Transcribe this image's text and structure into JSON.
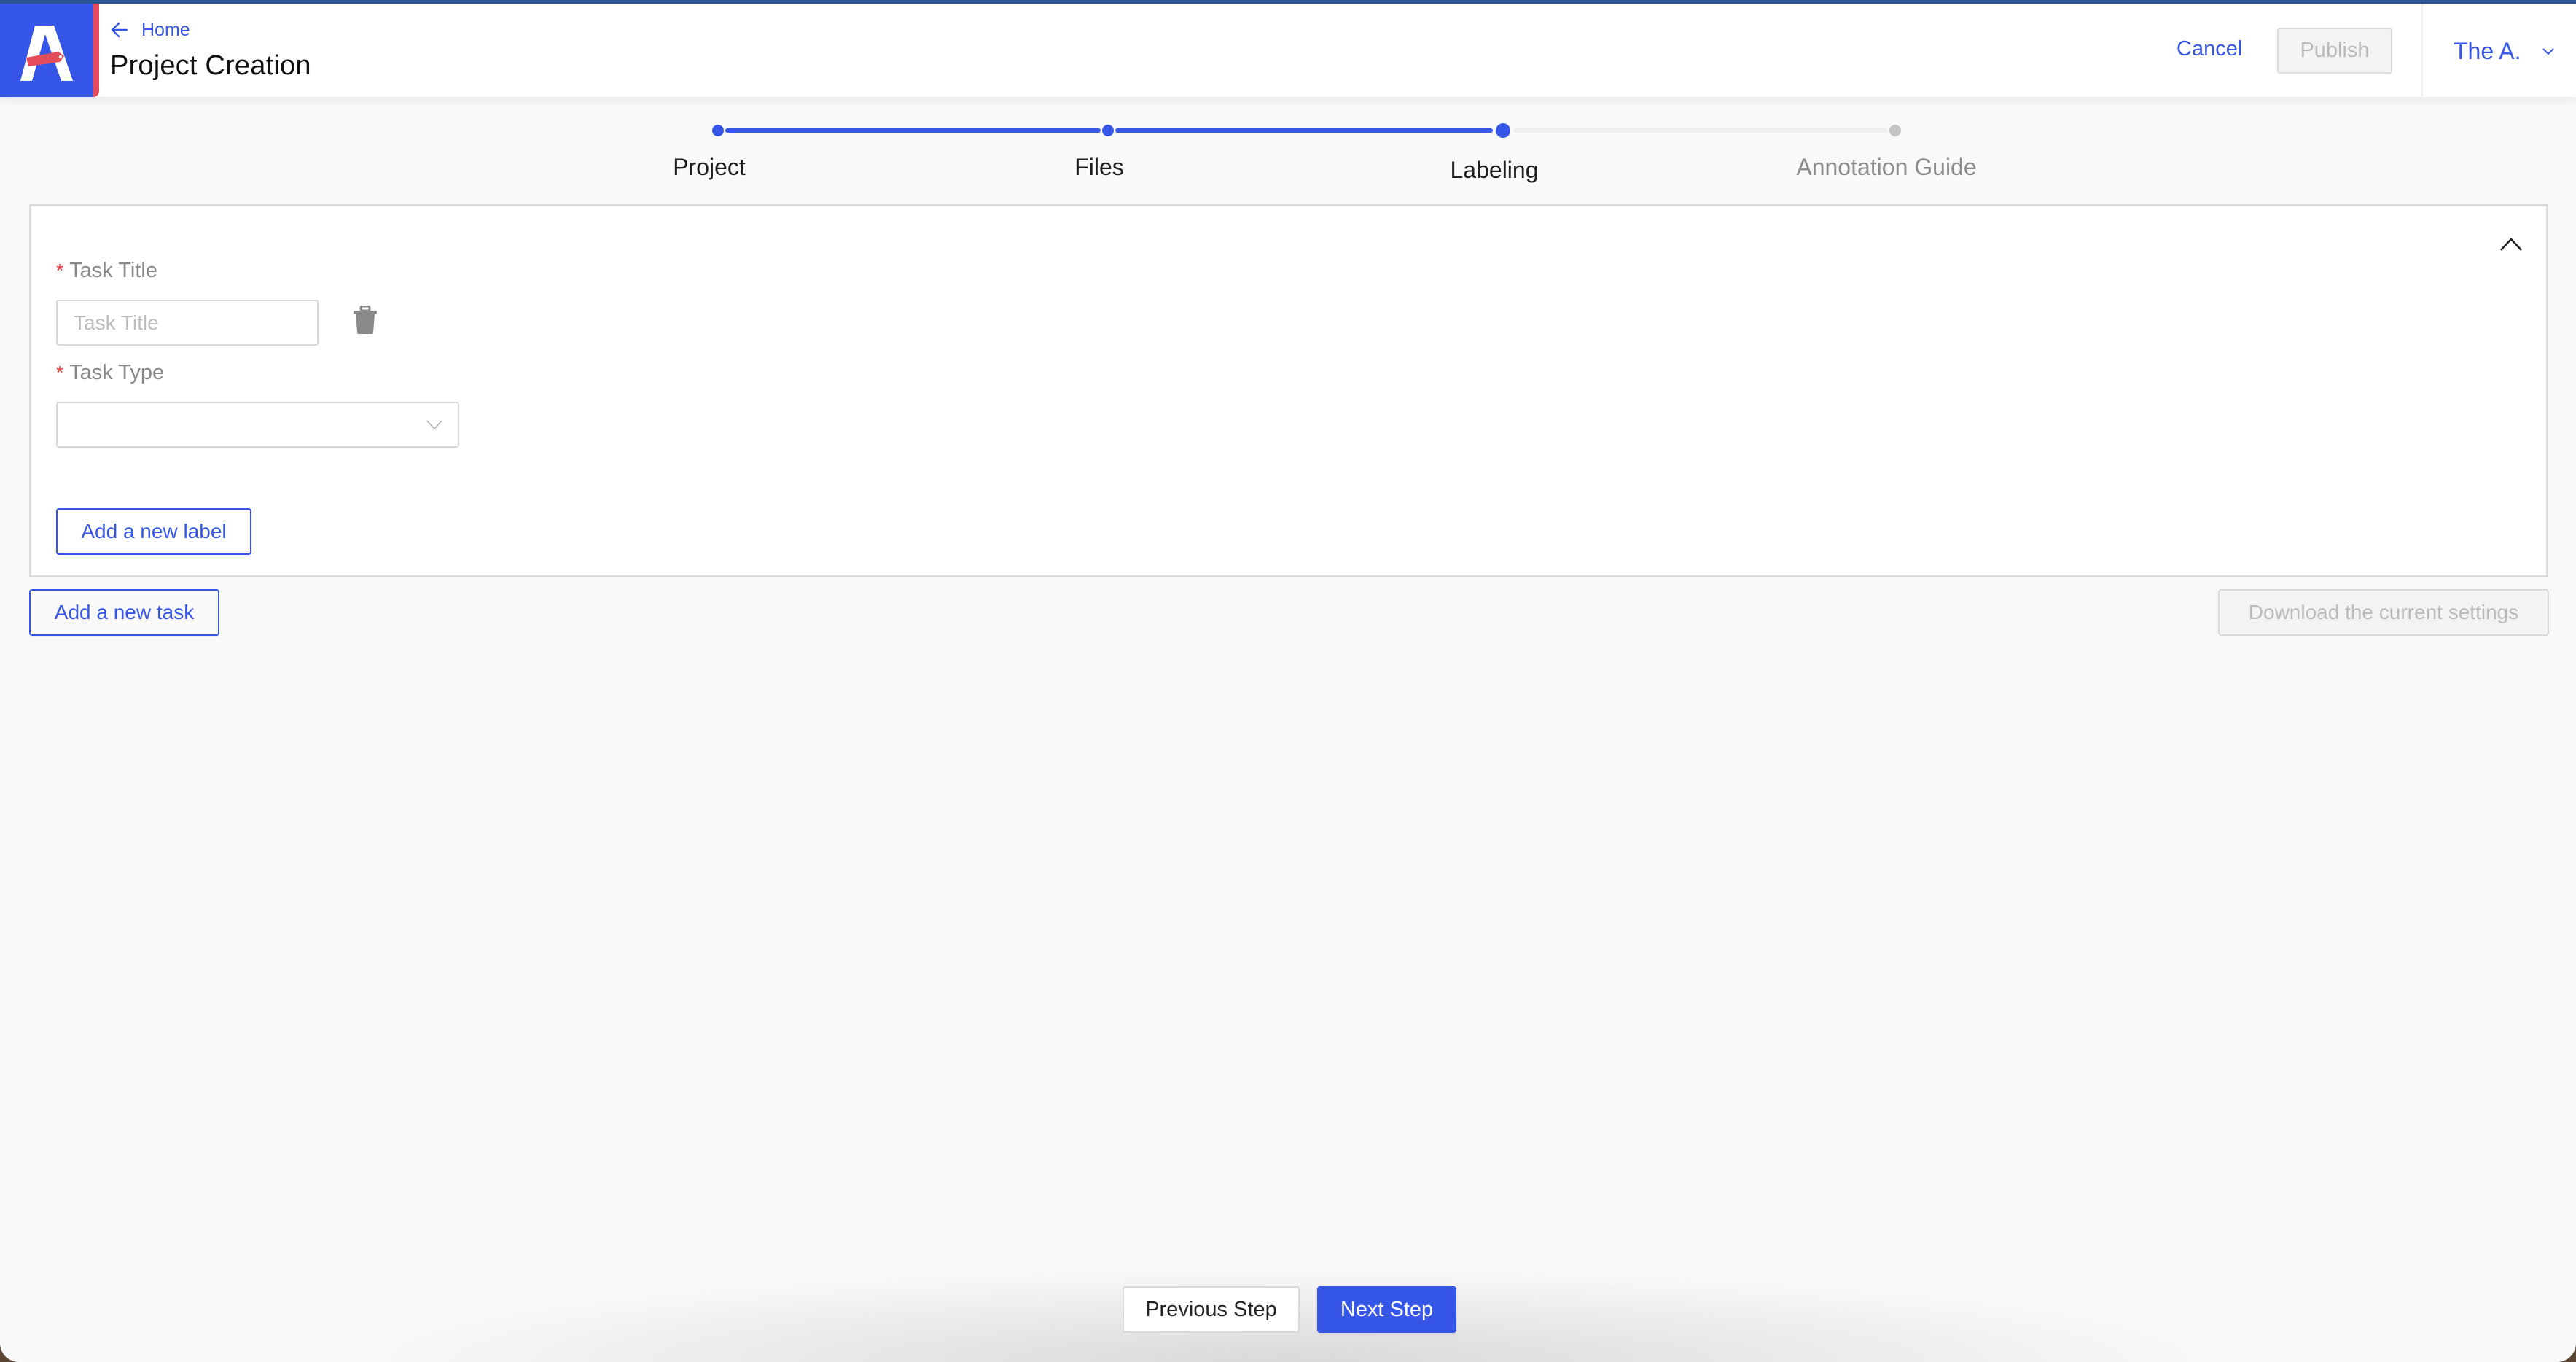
{
  "theme": {
    "primary": "#3656e8",
    "accent_red": "#e44c5b",
    "inactive_step": "#c4c4c4",
    "inactive_track": "#efefef",
    "required_mark": "#e53935"
  },
  "header": {
    "logo_letter": "A",
    "back_link": {
      "icon": "arrow-left-icon",
      "label": "Home"
    },
    "title": "Project Creation",
    "cancel_label": "Cancel",
    "publish_label": "Publish",
    "publish_disabled": true,
    "user": {
      "name": "The A.",
      "icon": "chevron-down-icon"
    }
  },
  "stepper": {
    "current_index": 2,
    "steps": [
      {
        "label": "Project",
        "status": "done"
      },
      {
        "label": "Files",
        "status": "done"
      },
      {
        "label": "Labeling",
        "status": "current"
      },
      {
        "label": "Annotation Guide",
        "status": "pending"
      }
    ]
  },
  "task_card": {
    "collapse_icon": "chevron-up-icon",
    "task_title": {
      "label": "Task Title",
      "required_mark": "*",
      "value": "",
      "placeholder": "Task Title"
    },
    "delete_icon": "trash-icon",
    "task_type": {
      "label": "Task Type",
      "required_mark": "*",
      "selected": "",
      "icon": "chevron-down-icon"
    },
    "add_label_button": "Add a new label"
  },
  "actions": {
    "add_task_button": "Add a new task",
    "download_settings_button": "Download the current settings",
    "download_disabled": true
  },
  "footer": {
    "previous_label": "Previous Step",
    "next_label": "Next Step"
  }
}
